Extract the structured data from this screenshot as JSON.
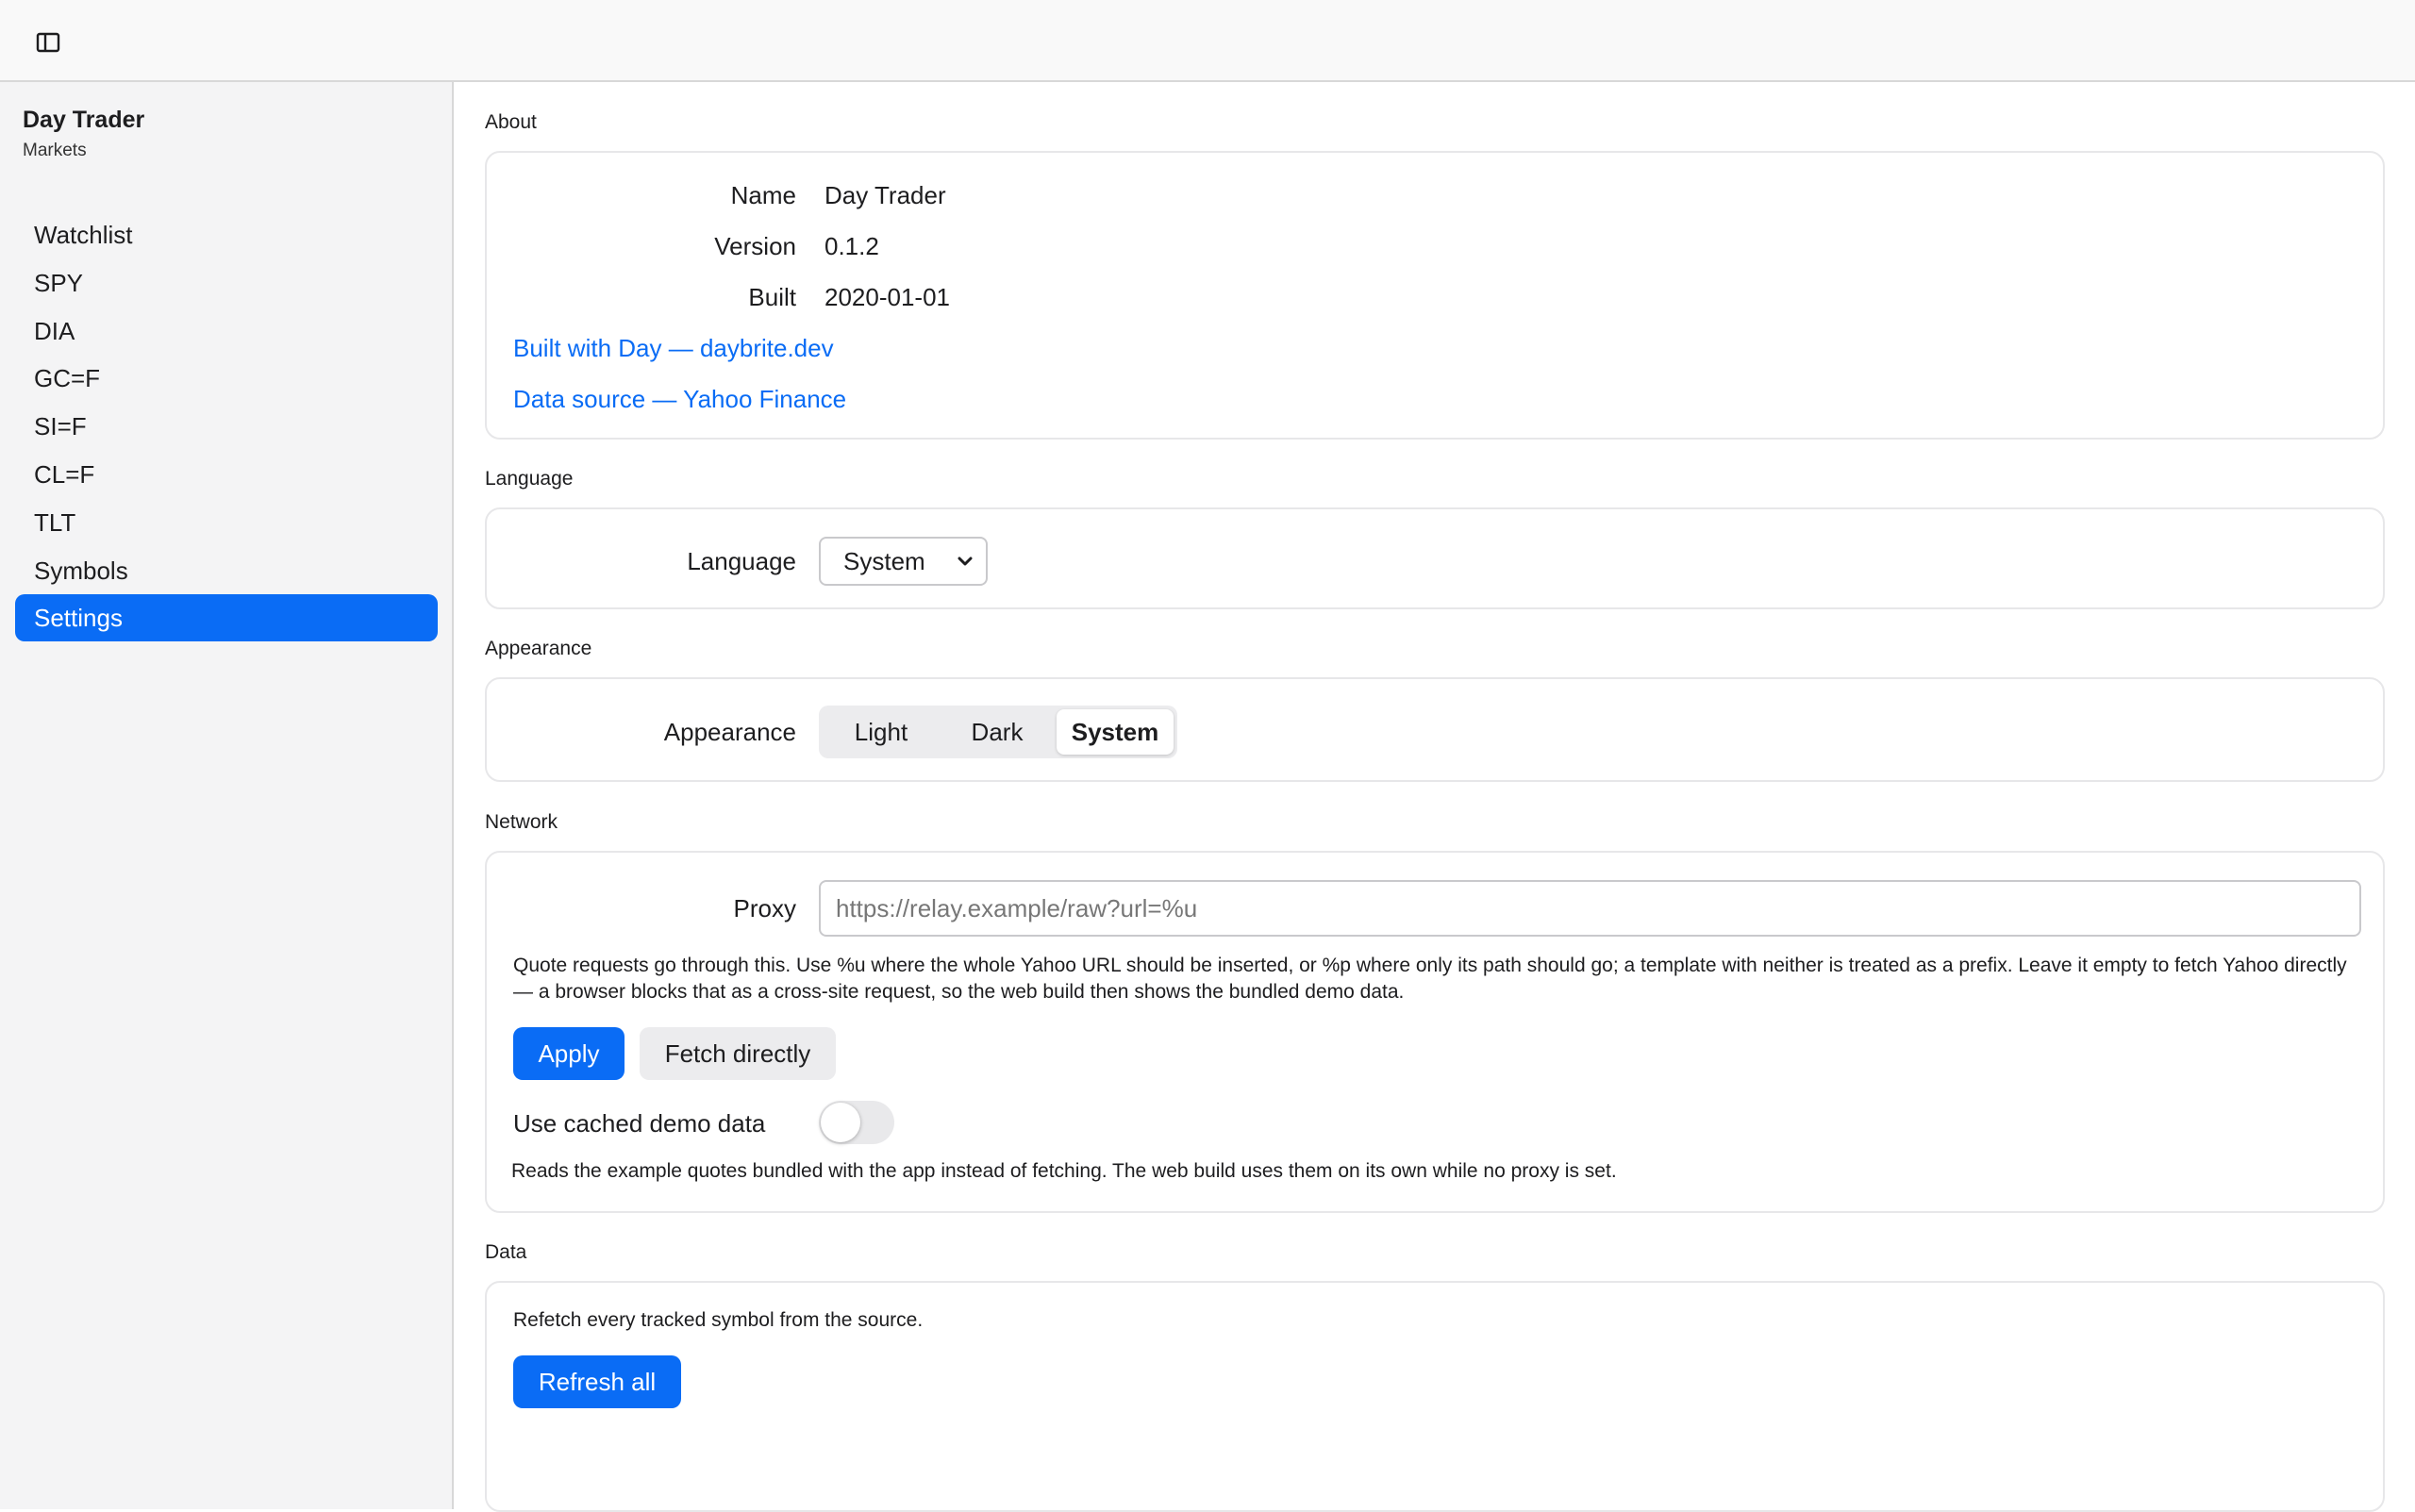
{
  "app": {
    "title": "Day Trader",
    "subtitle": "Markets"
  },
  "sidebar": {
    "items": [
      {
        "label": "Watchlist"
      },
      {
        "label": "SPY"
      },
      {
        "label": "DIA"
      },
      {
        "label": "GC=F"
      },
      {
        "label": "SI=F"
      },
      {
        "label": "CL=F"
      },
      {
        "label": "TLT"
      },
      {
        "label": "Symbols"
      },
      {
        "label": "Settings",
        "active": true
      }
    ]
  },
  "about": {
    "heading": "About",
    "name_label": "Name",
    "name_value": "Day Trader",
    "version_label": "Version",
    "version_value": "0.1.2",
    "built_label": "Built",
    "built_value": "2020-01-01",
    "link_built_with": "Built with Day — daybrite.dev",
    "link_data_source": "Data source — Yahoo Finance"
  },
  "language": {
    "heading": "Language",
    "label": "Language",
    "selected": "System"
  },
  "appearance": {
    "heading": "Appearance",
    "label": "Appearance",
    "options": [
      "Light",
      "Dark",
      "System"
    ],
    "selected": "System"
  },
  "network": {
    "heading": "Network",
    "proxy_label": "Proxy",
    "proxy_value": "",
    "proxy_placeholder": "https://relay.example/raw?url=%u",
    "proxy_help": "Quote requests go through this. Use %u where the whole Yahoo URL should be inserted, or %p where only its path should go; a template with neither is treated as a prefix. Leave it empty to fetch Yahoo directly — a browser blocks that as a cross-site request, so the web build then shows the bundled demo data.",
    "apply_label": "Apply",
    "fetch_directly_label": "Fetch directly",
    "cached_label": "Use cached demo data",
    "cached_on": false,
    "cached_help": "Reads the example quotes bundled with the app instead of fetching. The web build uses them on its own while no proxy is set."
  },
  "data": {
    "heading": "Data",
    "help": "Refetch every tracked symbol from the source.",
    "refresh_label": "Refresh all"
  },
  "colors": {
    "accent": "#0a6cf5",
    "sidebar_bg": "#f4f4f5",
    "card_border": "#e7e7e9"
  }
}
